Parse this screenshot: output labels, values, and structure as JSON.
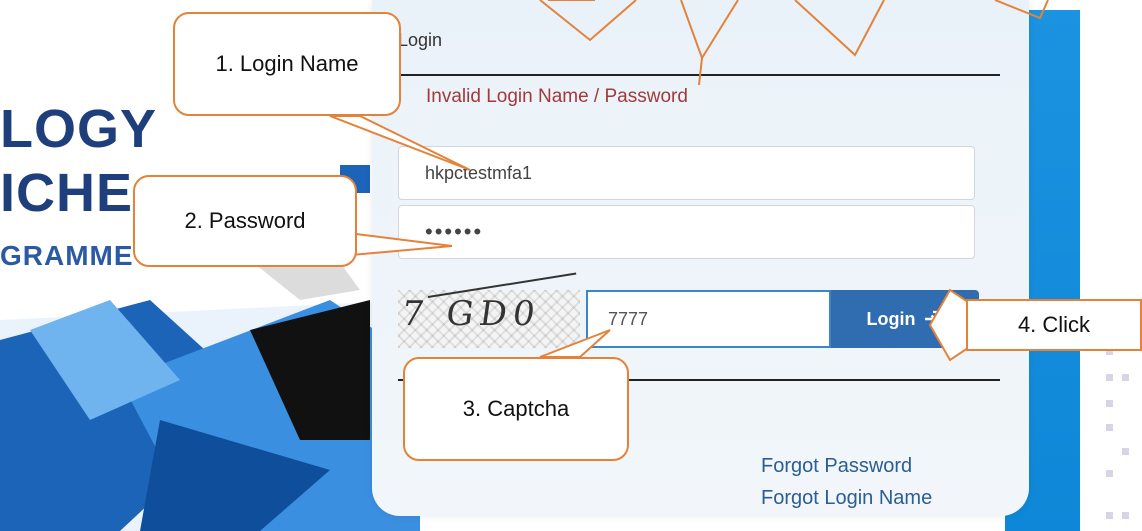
{
  "banner": {
    "line1": "LOGY",
    "line2": "ICHE",
    "line3": "GRAMME"
  },
  "login": {
    "title": "Login",
    "error": "Invalid Login Name / Password",
    "username_value": "hkpctestmfa1",
    "password_value": "••••••",
    "captcha_image_text": "7 GD0",
    "captcha_value": "7777",
    "login_button_label": "Login",
    "forgot_password": "Forgot Password",
    "forgot_login_name": "Forgot Login Name"
  },
  "callouts": {
    "c1": "1. Login Name",
    "c2": "2. Password",
    "c3": "3. Captcha",
    "c4": "4. Click"
  },
  "colors": {
    "callout_border": "#e4823a",
    "error": "#a23a3a",
    "button": "#2f6db0",
    "link": "#2b5e92",
    "accent_strip": "#1b93e0"
  },
  "icons": {
    "login_button": "login-enter-icon"
  }
}
